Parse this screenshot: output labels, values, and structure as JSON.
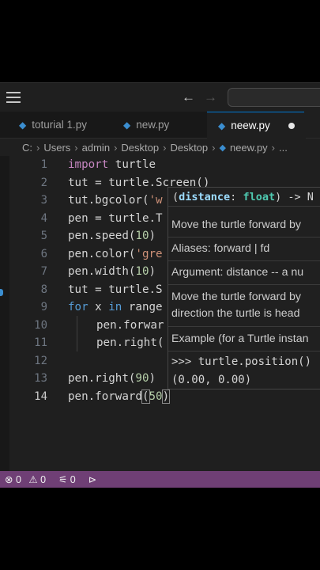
{
  "titlebar": {
    "menu_icon": "hamburger-menu-icon",
    "back_icon": "arrow-left-icon",
    "forward_icon": "arrow-right-icon",
    "back_glyph": "←",
    "forward_glyph": "→"
  },
  "tabs": [
    {
      "label": "toturial 1.py",
      "active": false
    },
    {
      "label": "new.py",
      "active": false
    },
    {
      "label": "neew.py",
      "active": true,
      "modified": true
    }
  ],
  "breadcrumb": [
    "C:",
    "Users",
    "admin",
    "Desktop",
    "Desktop",
    "neew.py",
    "..."
  ],
  "editor": {
    "lines": [
      {
        "n": "1"
      },
      {
        "n": "2"
      },
      {
        "n": "3"
      },
      {
        "n": "4"
      },
      {
        "n": "5"
      },
      {
        "n": "6"
      },
      {
        "n": "7"
      },
      {
        "n": "8"
      },
      {
        "n": "9"
      },
      {
        "n": "10"
      },
      {
        "n": "11"
      },
      {
        "n": "12"
      },
      {
        "n": "13"
      },
      {
        "n": "14"
      }
    ],
    "code": {
      "l1_kw": "import",
      "l1_rest": " turtle",
      "l2": "tut = turtle.Screen()",
      "l3_a": "tut.bgcolor(",
      "l3_s": "'w",
      "l4": "pen = turtle.T",
      "l5_a": "pen.speed(",
      "l5_n": "10",
      "l5_b": ")",
      "l6_a": "pen.color(",
      "l6_s": "'gre",
      "l7_a": "pen.width(",
      "l7_n": "10",
      "l7_b": ")",
      "l8": "tut = turtle.S",
      "l9_for": "for",
      "l9_x": " x ",
      "l9_in": "in",
      "l9_r": " range",
      "l10": "pen.forwar",
      "l11": "pen.right(",
      "l13_a": "pen.right(",
      "l13_n": "90",
      "l13_b": ")",
      "l14_a": "pen.forward",
      "l14_p": "(",
      "l14_n": "50",
      "l14_c": ")"
    }
  },
  "hover": {
    "sig_open": "(",
    "sig_param": "distance",
    "sig_colon": ": ",
    "sig_type": "float",
    "sig_close": ") -> N",
    "line1": "Move the turtle forward by",
    "aliases": "Aliases: forward | fd",
    "argument": "Argument: distance -- a nu",
    "line4": "Move the turtle forward by",
    "line5": "direction the turtle is head",
    "example": "Example (for a Turtle instan",
    "code1": ">>> turtle.position()",
    "code2": "(0.00, 0.00)"
  },
  "statusbar": {
    "errors": "0",
    "warnings": "0",
    "ports": "0",
    "error_icon": "error-circle-icon",
    "warning_icon": "warning-triangle-icon",
    "ports_icon": "broadcast-icon",
    "remote_icon": "remote-play-icon"
  },
  "colors": {
    "accent": "#0078d4",
    "statusbar": "#6f3f75",
    "editor_bg": "#1f1f1f",
    "keyword": "#569cd6",
    "string": "#ce9178",
    "number": "#b5cea8"
  }
}
